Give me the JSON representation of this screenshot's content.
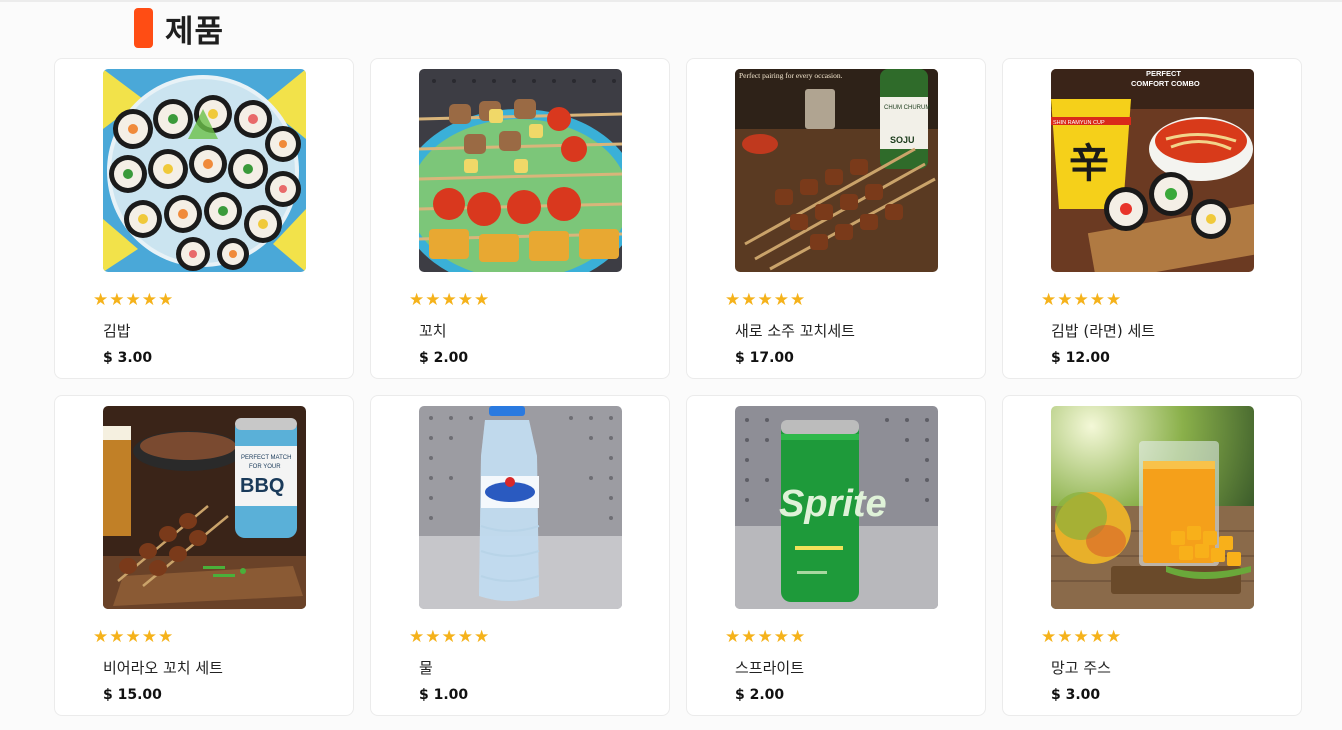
{
  "section": {
    "title": "제품",
    "accent_color": "#ff4d14"
  },
  "star_color": "#f5b21b",
  "products": [
    {
      "name": "김밥",
      "price": "$ 3.00",
      "rating": 5,
      "image_icon": "kimbap-photo-icon"
    },
    {
      "name": "꼬치",
      "price": "$ 2.00",
      "rating": 5,
      "image_icon": "skewer-photo-icon"
    },
    {
      "name": "새로 소주 꼬치세트",
      "price": "$ 17.00",
      "rating": 5,
      "image_icon": "soju-skewer-photo-icon",
      "image_text": [
        "Perfect pairing for every occasion.",
        "CHUM CHURUM",
        "SOJU"
      ]
    },
    {
      "name": "김밥 (라면) 세트",
      "price": "$ 12.00",
      "rating": 5,
      "image_icon": "kimbap-ramyun-photo-icon",
      "image_text": [
        "PERFECT",
        "COMFORT COMBO",
        "SHIN RAMYUN CUP",
        "辛"
      ]
    },
    {
      "name": "비어라오 꼬치 세트",
      "price": "$ 15.00",
      "rating": 5,
      "image_icon": "beerlao-skewer-photo-icon",
      "image_text": [
        "PERFECT MATCH",
        "FOR YOUR",
        "BBQ"
      ]
    },
    {
      "name": "물",
      "price": "$ 1.00",
      "rating": 5,
      "image_icon": "water-bottle-photo-icon"
    },
    {
      "name": "스프라이트",
      "price": "$ 2.00",
      "rating": 5,
      "image_icon": "sprite-can-photo-icon",
      "image_text": [
        "Sprite"
      ]
    },
    {
      "name": "망고 주스",
      "price": "$ 3.00",
      "rating": 5,
      "image_icon": "mango-juice-photo-icon"
    }
  ]
}
